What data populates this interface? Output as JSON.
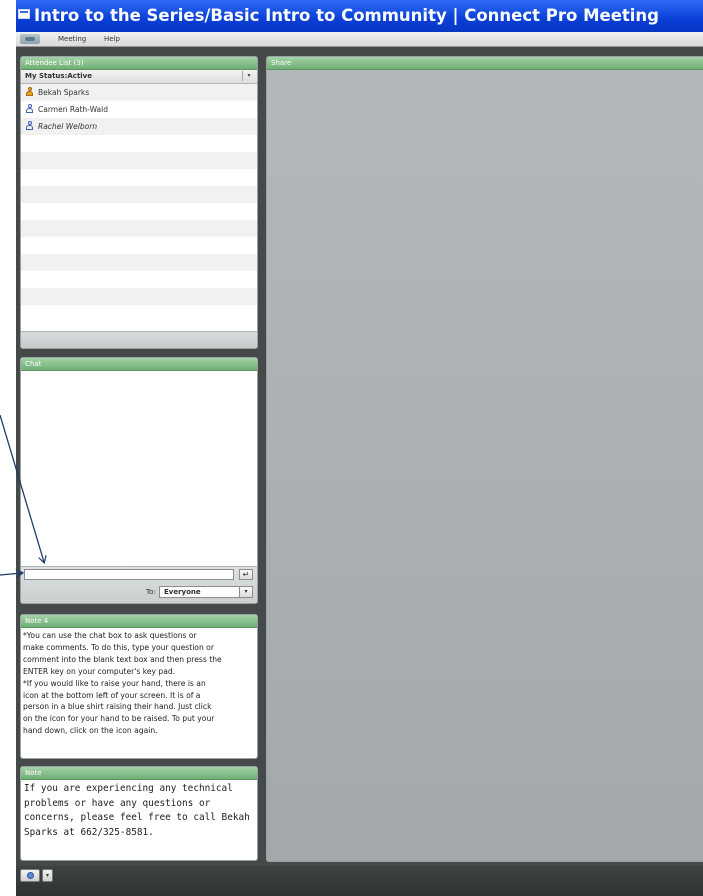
{
  "window": {
    "title": "Intro to the Series/Basic Intro to Community | Connect Pro Meeting"
  },
  "menu": {
    "items": [
      "Meeting",
      "Help"
    ]
  },
  "attendee_pod": {
    "title": "Attendee List (3)",
    "status": "My Status:Active",
    "attendees": [
      {
        "name": "Bekah Sparks",
        "role": "host"
      },
      {
        "name": "Carmen Rath-Wald",
        "role": "participant"
      },
      {
        "name": "Rachel Welborn",
        "role": "participant"
      }
    ]
  },
  "chat_pod": {
    "title": "Chat",
    "input_value": "",
    "send_icon": "enter-icon",
    "to_label": "To:",
    "to_value": "Everyone"
  },
  "note4_pod": {
    "title": "Note 4",
    "text": "*You can use the chat box to ask questions or\nmake comments. To do this, type your question or\ncomment into the blank text box and then press the\nENTER key on your computer's key pad.\n*If you would like to raise your hand, there is an\nicon at the bottom left of your screen. It is of a\nperson in a blue shirt raising their hand. Just click\non the icon for your hand to be raised. To put your\nhand down, click on the icon again."
  },
  "note_pod": {
    "title": "Note",
    "text": "If you are experiencing any technical\nproblems or have any questions or\nconcerns, please feel free to call Bekah\nSparks at 662/325-8581."
  },
  "share_pod": {
    "title": "Share"
  },
  "colors": {
    "titlebar": "#0a3fd6",
    "pod_header": "#6fae74",
    "arrow": "#1e3a6b"
  }
}
